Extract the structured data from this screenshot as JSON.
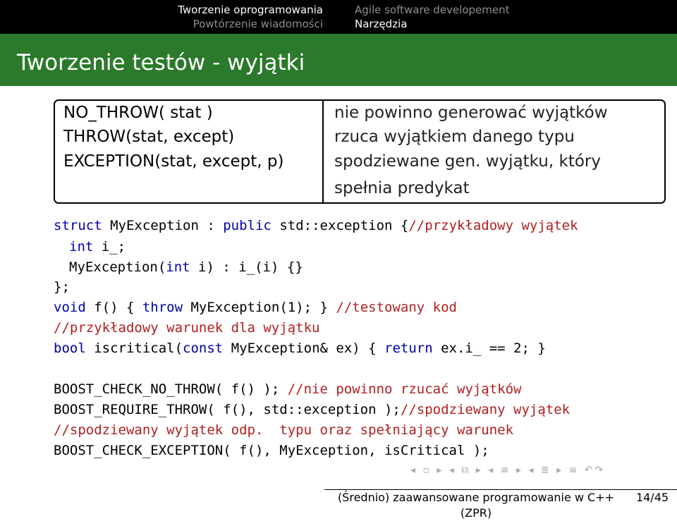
{
  "nav": {
    "left": [
      "Tworzenie oprogramowania",
      "Powtórzenie wiadomości"
    ],
    "right": [
      "Agile software developement",
      "Narzędzia"
    ]
  },
  "title": "Tworzenie testów - wyjątki",
  "table": {
    "rows": [
      {
        "macro": "NO_THROW( stat )",
        "desc": "nie powinno generować wyjątków"
      },
      {
        "macro": "THROW(stat, except)",
        "desc": "rzuca wyjątkiem danego typu"
      },
      {
        "macro": "EXCEPTION(stat, except, p)",
        "desc": "spodziewane gen. wyjątku, który spełnia predykat"
      }
    ]
  },
  "code": {
    "l1_kw1": "struct",
    "l1_t1": " MyException : ",
    "l1_kw2": "public",
    "l1_t2": " std::exception {",
    "l1_cm": "//przykładowy wyjątek",
    "l2_kw": "int",
    "l2_t": " i_;",
    "l3_t1": "MyException(",
    "l3_kw": "int",
    "l3_t2": " i) : i_(i) {}",
    "l4_t": "};",
    "l5_kw1": "void",
    "l5_t1": " f() { ",
    "l5_kw2": "throw",
    "l5_t2": " MyException(1); } ",
    "l5_cm": "//testowany kod",
    "l6_cm": "//przykładowy warunek dla wyjątku",
    "l7_kw1": "bool",
    "l7_t1": " iscritical(",
    "l7_kw2": "const",
    "l7_t2": " MyException& ex) { ",
    "l7_kw3": "return",
    "l7_t3": " ex.i_ == 2; }",
    "l8_t": "BOOST_CHECK_NO_THROW( f() ); ",
    "l8_cm": "//nie powinno rzucać wyjątków",
    "l9_t": "BOOST_REQUIRE_THROW( f(), std::exception );",
    "l9_cm": "//spodziewany wyjątek",
    "l10_cm": "//spodziewany wyjątek odp.  typu oraz spełniający warunek",
    "l11_t": "BOOST_CHECK_EXCEPTION( f(), MyException, isCritical );"
  },
  "footer": {
    "title": "(Średnio) zaawansowane programowanie w C++ (ZPR)",
    "page": "14/45"
  },
  "colors": {
    "title_bg": "#2b7a2b",
    "keyword": "#0000a8",
    "comment": "#b01f1f"
  }
}
